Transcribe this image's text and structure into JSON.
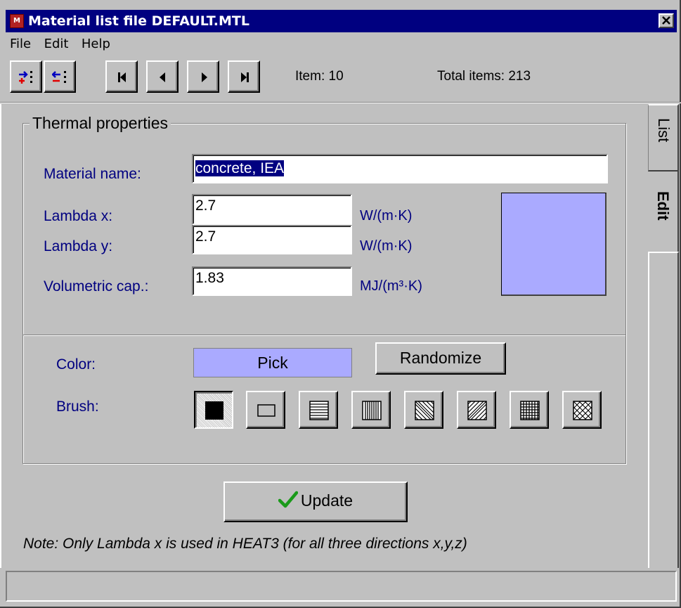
{
  "window": {
    "title": "Material list file DEFAULT.MTL",
    "app_icon_text": "M"
  },
  "menu": {
    "items": [
      {
        "label": "File"
      },
      {
        "label": "Edit"
      },
      {
        "label": "Help"
      }
    ]
  },
  "toolbar": {
    "item_text": "Item: 10",
    "total_text": "Total items: 213",
    "buttons": [
      "add-item-icon",
      "delete-item-icon",
      "first-record-icon",
      "previous-record-icon",
      "next-record-icon",
      "last-record-icon"
    ]
  },
  "tabs": [
    {
      "label": "List",
      "selected": false
    },
    {
      "label": "Edit",
      "selected": true
    }
  ],
  "thermal": {
    "group_title": "Thermal properties",
    "name_label": "Material name:",
    "name_value": "concrete, IEA",
    "lambda_x_label": "Lambda  x:",
    "lambda_x_value": "2.7",
    "lambda_x_unit": "W/(m·K)",
    "lambda_y_label": "Lambda  y:",
    "lambda_y_value": "2.7",
    "lambda_y_unit": "W/(m·K)",
    "volcap_label": "Volumetric cap.:",
    "volcap_value": "1.83",
    "volcap_unit": "MJ/(m³·K)"
  },
  "appearance": {
    "color_label": "Color:",
    "pick_label": "Pick",
    "randomize_label": "Randomize",
    "brush_label": "Brush:",
    "selected_color": "#aaaaff",
    "brushes": [
      "solid-brush-icon",
      "clear-brush-icon",
      "horizontal-brush-icon",
      "vertical-brush-icon",
      "fdiagonal-brush-icon",
      "bdiagonal-brush-icon",
      "cross-brush-icon",
      "diagcross-brush-icon"
    ],
    "selected_brush": "solid-brush-icon"
  },
  "update_label": "Update",
  "note": "Note: Only Lambda  x is used in HEAT3 (for all three directions x,y,z)",
  "status_text": ""
}
